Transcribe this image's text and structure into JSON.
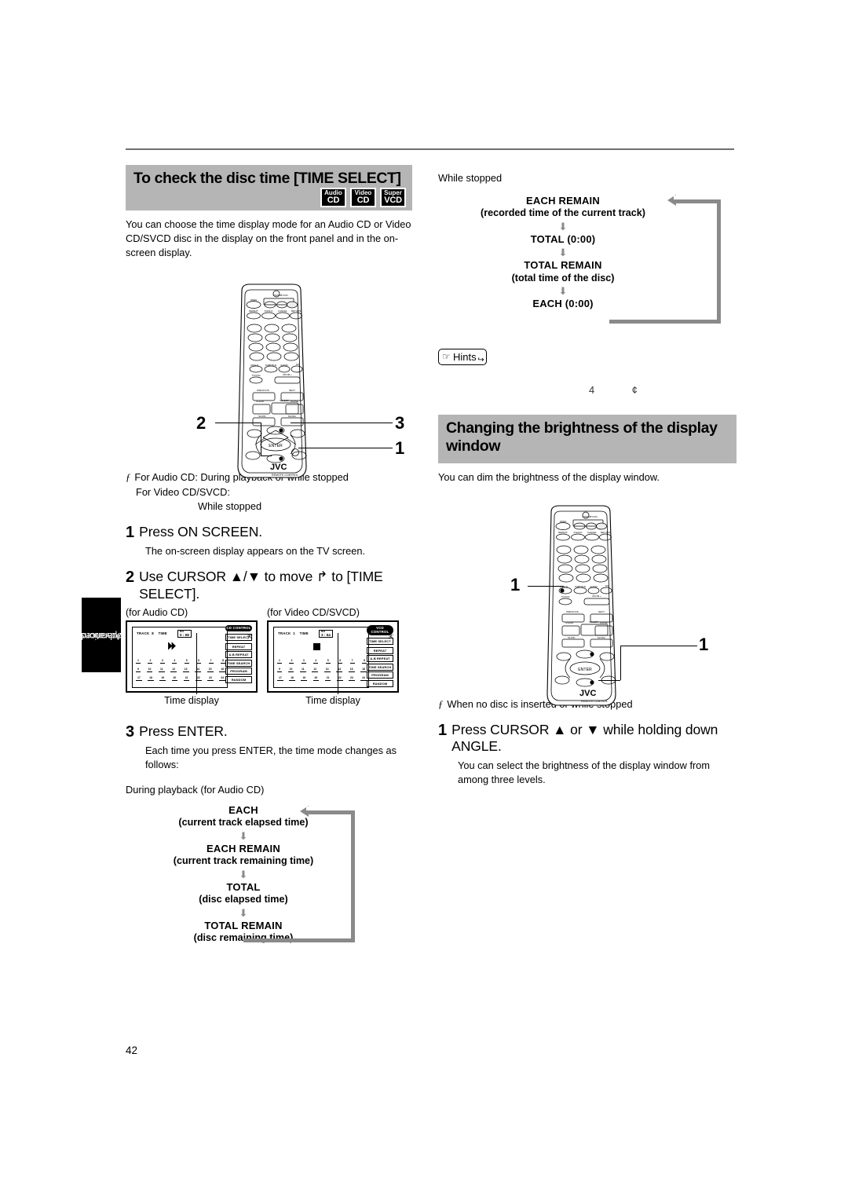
{
  "page": {
    "number": "42"
  },
  "side_tab": {
    "line1": "Advanced",
    "line2": "operations"
  },
  "left": {
    "heading": "To check the disc time [TIME SELECT]",
    "badges": [
      {
        "top": "Audio",
        "bottom": "CD"
      },
      {
        "top": "Video",
        "bottom": "CD"
      },
      {
        "top": "Super",
        "bottom": "VCD"
      }
    ],
    "intro": "You can choose the time display mode for an Audio CD or Video CD/SVCD disc in the display on the front panel and in the on-screen display.",
    "remote_callouts": [
      "2",
      "3",
      "1"
    ],
    "remote_brand": "JVC",
    "remote_sub": "REMOTE CONTROL",
    "condition_line1": "For Audio CD: During playback or while stopped",
    "condition_line2": "For Video CD/SVCD:",
    "condition_line3": "While stopped",
    "step1_num": "1",
    "step1_text": "Press ON SCREEN.",
    "step1_sub": "The on-screen display appears on the TV screen.",
    "step2_num": "2",
    "step2_text": "Use CURSOR ▲/▼ to move ↱ to [TIME SELECT].",
    "osd_audio_caption": "(for Audio CD)",
    "osd_video_caption": "(for Video CD/SVCD)",
    "osd_audio": {
      "track_label": "TRACK",
      "track_value": "8",
      "time_label": "TIME",
      "time_value": "0 : 58",
      "mini_left": "MIN",
      "mini_right": "SEC",
      "mini_mode": "EACH",
      "menu_title": "CD CONTROL",
      "menu_items": [
        "TIME SELECT",
        "REPEAT",
        "A-B REPEAT",
        "TIME SEARCH",
        "PROGRAM",
        "RANDOM"
      ],
      "tracks_row1": [
        "1",
        "2",
        "3",
        "4",
        "5",
        "6",
        "7",
        "8"
      ],
      "tracks_row2": [
        "9",
        "10",
        "11",
        "12",
        "13",
        "14",
        "15",
        "16"
      ],
      "tracks_row3": [
        "17",
        "18",
        "19",
        "20",
        "21",
        "22",
        "23",
        "24"
      ],
      "caption": "Time display"
    },
    "osd_video": {
      "track_label": "TRACK",
      "track_value": "1",
      "time_label": "TIME",
      "time_value": "3 : 54",
      "mini_left": "MIN",
      "mini_right": "SEC",
      "mini_mode": "TOTAL",
      "menu_title": "VCD CONTROL",
      "menu_items": [
        "TIME SELECT",
        "REPEAT",
        "A-B REPEAT",
        "TIME SEARCH",
        "PROGRAM",
        "RANDOM"
      ],
      "tracks_row1": [
        "1",
        "2",
        "3",
        "4",
        "5",
        "6",
        "7",
        "8"
      ],
      "tracks_row2": [
        "9",
        "10",
        "11",
        "12",
        "13",
        "14",
        "15",
        "16"
      ],
      "tracks_row3": [
        "17",
        "18",
        "19",
        "20",
        "21",
        "22",
        "23",
        "24"
      ],
      "caption": "Time display"
    },
    "step3_num": "3",
    "step3_text": "Press ENTER.",
    "step3_sub": "Each time you press ENTER, the time mode changes as follows:",
    "flow_caption": "During playback (for Audio CD)",
    "flow": [
      {
        "main": "EACH",
        "sub": "(current track elapsed time)"
      },
      {
        "main": "EACH REMAIN",
        "sub": "(current track remaining time)"
      },
      {
        "main": "TOTAL",
        "sub": "(disc elapsed time)"
      },
      {
        "main": "TOTAL REMAIN",
        "sub": "(disc remaining time)"
      }
    ]
  },
  "right": {
    "flow_caption": "While stopped",
    "flow": [
      {
        "main": "EACH REMAIN",
        "sub": "(recorded time of the current track)"
      },
      {
        "main": "TOTAL  (0:00)",
        "sub": ""
      },
      {
        "main": "TOTAL  REMAIN",
        "sub": "(total time of the disc)"
      },
      {
        "main": "EACH  (0:00)",
        "sub": ""
      }
    ],
    "hints_label": "Hints",
    "hints_frag1": "4",
    "hints_frag2": "¢",
    "heading": "Changing the brightness of the display window",
    "intro": "You can dim the brightness of the display window.",
    "remote_callouts": [
      "1",
      "1"
    ],
    "remote_brand": "JVC",
    "remote_sub": "REMOTE CONTROL",
    "condition": "When no disc is inserted or while stopped",
    "step1_num": "1",
    "step1_text": "Press CURSOR ▲ or ▼ while holding down ANGLE.",
    "step1_sub": "You can select the brightness of the display window from among three levels."
  }
}
